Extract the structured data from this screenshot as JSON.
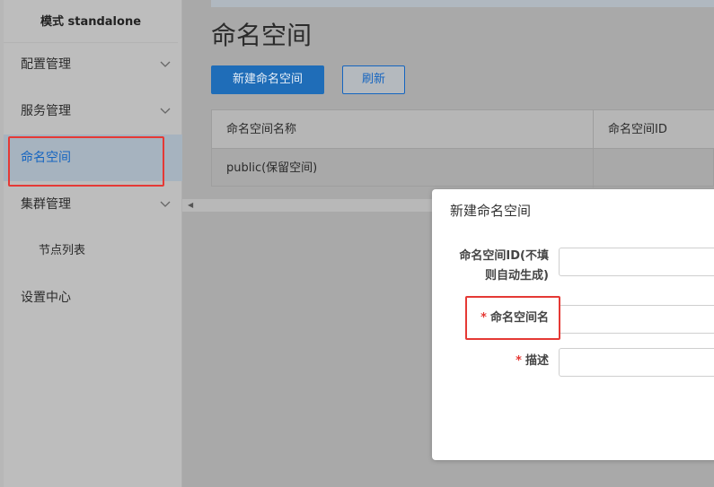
{
  "sidebar": {
    "mode_label": "模式 standalone",
    "items": [
      {
        "label": "配置管理",
        "has_chevron": true
      },
      {
        "label": "服务管理",
        "has_chevron": true
      },
      {
        "label": "命名空间",
        "active": true
      },
      {
        "label": "集群管理",
        "has_chevron": true
      },
      {
        "label": "节点列表",
        "sub": true
      },
      {
        "label": "设置中心"
      }
    ]
  },
  "main": {
    "title": "命名空间",
    "buttons": {
      "create": "新建命名空间",
      "refresh": "刷新"
    },
    "table": {
      "headers": [
        "命名空间名称",
        "命名空间ID"
      ],
      "rows": [
        [
          "public(保留空间)",
          ""
        ]
      ]
    }
  },
  "dialog": {
    "title": "新建命名空间",
    "fields": {
      "ns_id_label_line1": "命名空间ID(不填",
      "ns_id_label_line2": "则自动生成)",
      "ns_name_label": "命名空间名",
      "desc_label": "描述",
      "required_mark": "*"
    }
  },
  "colors": {
    "accent": "#1565c0",
    "highlight": "#e53935"
  }
}
